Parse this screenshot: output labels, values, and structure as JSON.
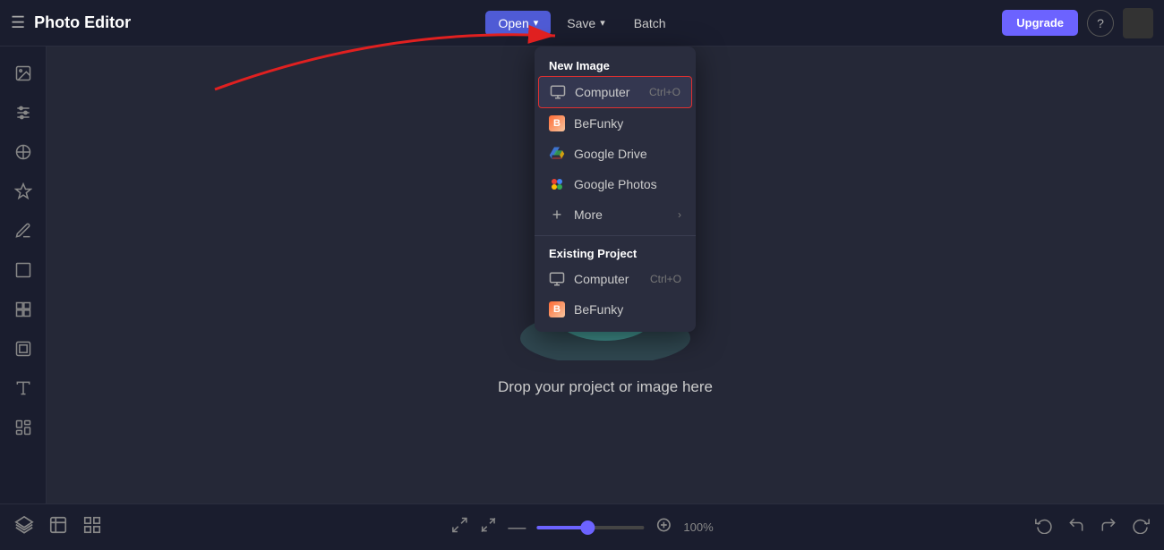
{
  "app": {
    "title": "Photo Editor"
  },
  "topbar": {
    "menu_icon": "☰",
    "open_label": "Open",
    "open_chevron": "▾",
    "save_label": "Save",
    "save_chevron": "▾",
    "batch_label": "Batch",
    "upgrade_label": "Upgrade",
    "help_icon": "?"
  },
  "dropdown": {
    "new_image_title": "New Image",
    "computer_label": "Computer",
    "computer_shortcut": "Ctrl+O",
    "befunky_label": "BeFunky",
    "google_drive_label": "Google Drive",
    "google_photos_label": "Google Photos",
    "more_label": "More",
    "existing_project_title": "Existing Project",
    "existing_computer_label": "Computer",
    "existing_computer_shortcut": "Ctrl+O",
    "existing_befunky_label": "BeFunky"
  },
  "main": {
    "drop_text": "Drop your project or image here"
  },
  "bottombar": {
    "zoom_value": "100%",
    "layers_icon": "⊞",
    "export_icon": "⬒",
    "grid_icon": "⊞"
  },
  "sidebar": {
    "icons": [
      "🖼",
      "⚙",
      "👁",
      "✦",
      "✏",
      "⬜",
      "⊞",
      "⬒",
      "T",
      "🖌"
    ]
  }
}
